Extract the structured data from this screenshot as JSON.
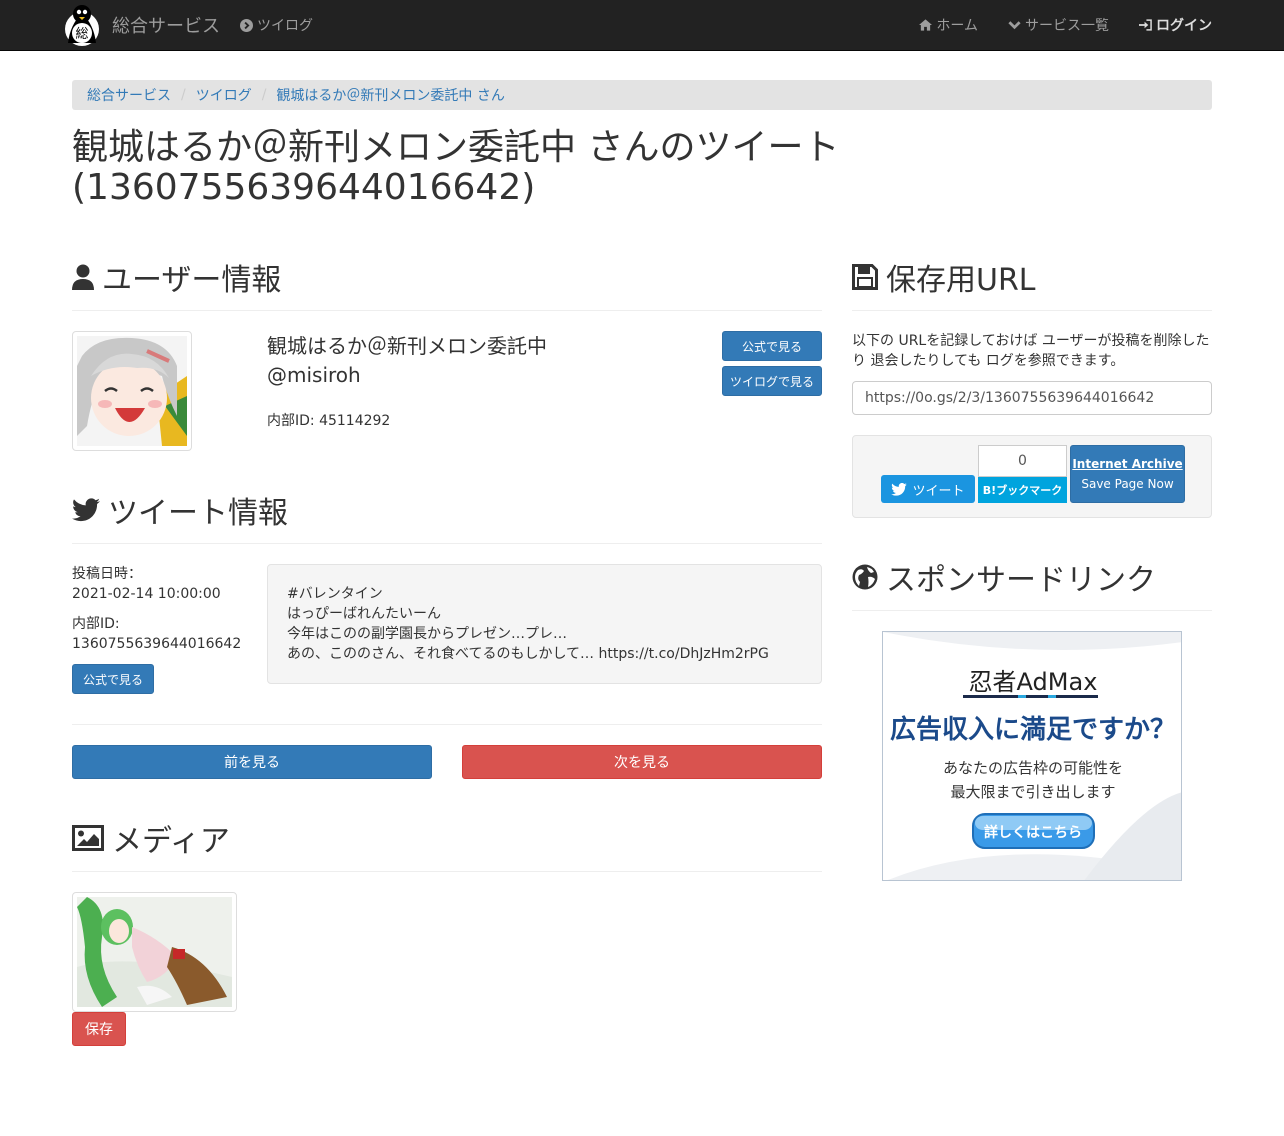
{
  "navbar": {
    "brand": "総合サービス",
    "brand_logo_text": "総",
    "left_link": "ツイログ",
    "right_links": [
      "ホーム",
      "サービス一覧",
      "ログイン"
    ]
  },
  "breadcrumb": [
    "総合サービス",
    "ツイログ",
    "観城はるか＠新刊メロン委託中 さん"
  ],
  "page_title_line1": "観城はるか＠新刊メロン委託中 さんのツイート",
  "page_title_line2": "(1360755639644016642)",
  "user_section": {
    "heading": "ユーザー情報",
    "name": "観城はるか＠新刊メロン委託中",
    "handle": "@misiroh",
    "internal_id": "内部ID: 45114292",
    "official_button": "公式で見る",
    "twilog_button": "ツイログで見る"
  },
  "tweet_section": {
    "heading": "ツイート情報",
    "posted_label": "投稿日時：",
    "posted_value": "2021-02-14 10:00:00",
    "id_label": "内部ID:",
    "id_value": "1360755639644016642",
    "official_button": "公式で見る",
    "text_lines": [
      "#バレンタイン",
      "はっぴーばれんたいーん",
      "今年はこのの副学園長からプレゼン…プレ…",
      "あの、こののさん、それ食べてるのもしかして… https://t.co/DhJzHm2rPG"
    ]
  },
  "pager": {
    "prev": "前を見る",
    "next": "次を見る"
  },
  "media_section": {
    "heading": "メディア",
    "save_button": "保存"
  },
  "save_section": {
    "heading": "保存用URL",
    "description": "以下の URLを記録しておけば ユーザーが投稿を削除したり 退会したりしても ログを参照できます。",
    "url": "https://0o.gs/2/3/1360755639644016642",
    "tweet_button": "ツイート",
    "hatena_count": "0",
    "hatena_button": "B!ブックマーク",
    "ia_title": "Internet Archive",
    "ia_sub": "Save Page Now"
  },
  "sponsor_section": {
    "heading": "スポンサードリンク",
    "ad_brand": "忍者AdMax",
    "ad_headline": "広告収入に満足ですか？",
    "ad_line1": "あなたの広告枠の可能性を",
    "ad_line2": "最大限まで引き出します",
    "ad_button": "詳しくはこちら"
  },
  "colors": {
    "navbar_bg": "#222222",
    "primary": "#337ab7",
    "danger": "#d9534f",
    "twitter": "#1b95e0",
    "hatena": "#00a4de"
  }
}
